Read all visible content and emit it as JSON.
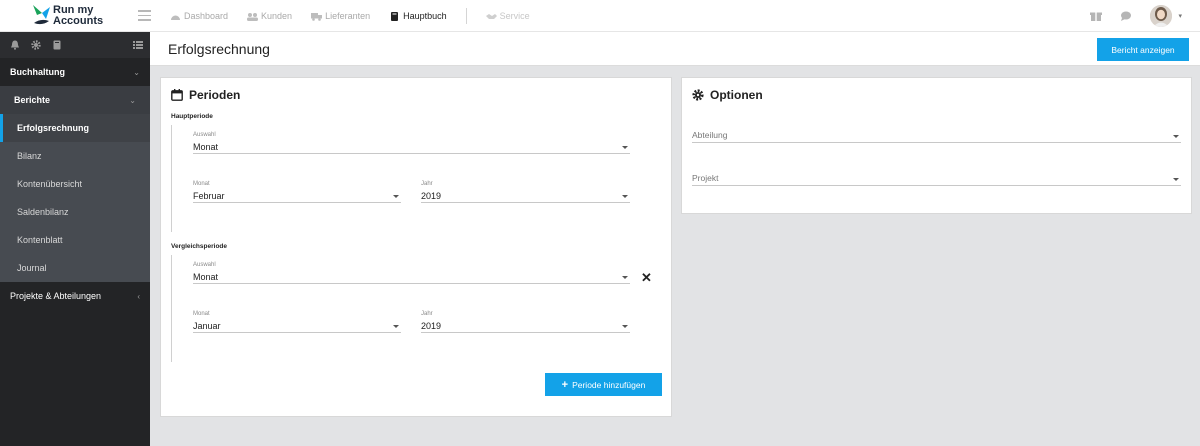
{
  "brand": {
    "line1": "Run my",
    "line2": "Accounts"
  },
  "nav": {
    "items": [
      {
        "label": "Dashboard",
        "icon": "dashboard-icon"
      },
      {
        "label": "Kunden",
        "icon": "users-icon"
      },
      {
        "label": "Lieferanten",
        "icon": "truck-icon"
      },
      {
        "label": "Hauptbuch",
        "icon": "book-icon"
      },
      {
        "label": "Service",
        "icon": "handshake-icon"
      }
    ]
  },
  "sidebar": {
    "section": "Buchhaltung",
    "group": "Berichte",
    "items": [
      {
        "label": "Erfolgsrechnung"
      },
      {
        "label": "Bilanz"
      },
      {
        "label": "Kontenübersicht"
      },
      {
        "label": "Saldenbilanz"
      },
      {
        "label": "Kontenblatt"
      },
      {
        "label": "Journal"
      }
    ],
    "projects": "Projekte & Abteilungen"
  },
  "page": {
    "title": "Erfolgsrechnung",
    "report_button": "Bericht anzeigen"
  },
  "periods": {
    "title": "Perioden",
    "main": {
      "label": "Hauptperiode",
      "selection_label": "Auswahl",
      "selection_value": "Monat",
      "month_label": "Monat",
      "month_value": "Februar",
      "year_label": "Jahr",
      "year_value": "2019"
    },
    "compare": {
      "label": "Vergleichsperiode",
      "selection_label": "Auswahl",
      "selection_value": "Monat",
      "month_label": "Monat",
      "month_value": "Januar",
      "year_label": "Jahr",
      "year_value": "2019"
    },
    "add_button": "Periode hinzufügen"
  },
  "options": {
    "title": "Optionen",
    "department_placeholder": "Abteilung",
    "project_placeholder": "Projekt"
  },
  "colors": {
    "accent": "#13a2e8",
    "sidebar": "#232426"
  }
}
